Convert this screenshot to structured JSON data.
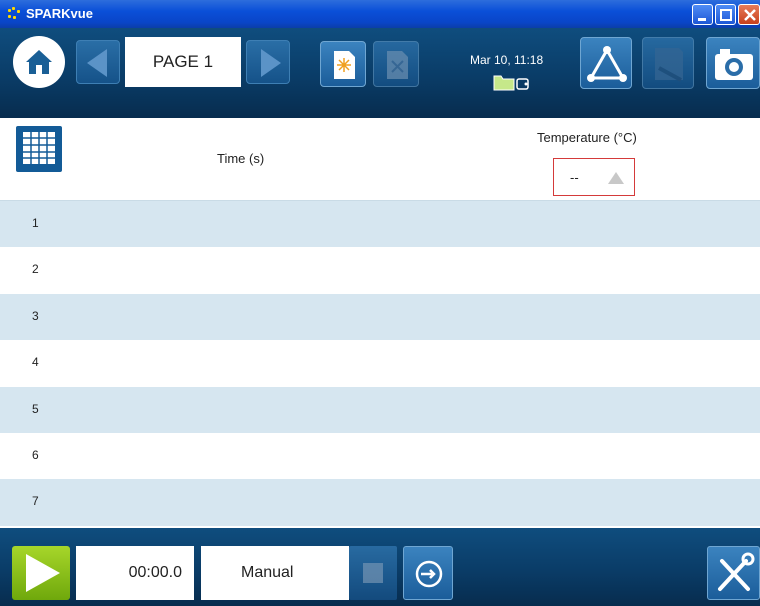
{
  "window": {
    "title": "SPARKvue"
  },
  "toolbar": {
    "page_label": "PAGE 1",
    "datetime": "Mar 10, 11:18"
  },
  "table": {
    "col_time": "Time (s)",
    "col_temp": "Temperature (°C)",
    "temp_value": "--",
    "rows": [
      "1",
      "2",
      "3",
      "4",
      "5",
      "6",
      "7"
    ]
  },
  "bottom": {
    "timer": "00:00.0",
    "mode": "Manual"
  },
  "colors": {
    "accent": "#0a3c67",
    "start": "#8cc21a",
    "row_alt": "#d6e6f0"
  }
}
